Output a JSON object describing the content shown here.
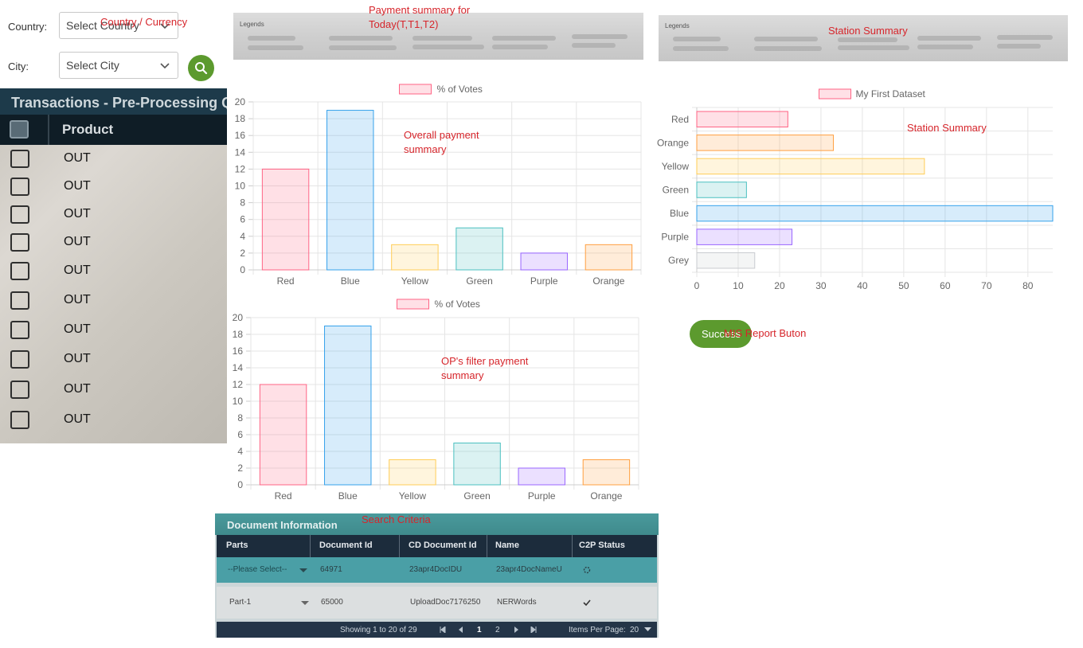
{
  "filters": {
    "country_label": "Country:",
    "country_placeholder": "Select Country",
    "city_label": "City:",
    "city_placeholder": "Select City",
    "search_icon": "search-icon"
  },
  "annotations": {
    "country_currency": "Country / Currency",
    "payment_summary_line1": "Payment summary for",
    "payment_summary_line2": "Today(T,T1,T2)",
    "station_summary_top": "Station Summary",
    "overall_line1": "Overall payment",
    "overall_line2": "summary",
    "op_line1": "OP's filter payment",
    "op_line2": "summary",
    "station_summary_chart": "Station Summary",
    "mis_report": "MIS Report Buton",
    "search_criteria": "Search Criteria"
  },
  "transactions": {
    "title": "Transactions - Pre-Processing Q",
    "column_product": "Product",
    "rows": [
      "OUT",
      "OUT",
      "OUT",
      "OUT",
      "OUT",
      "OUT",
      "OUT",
      "OUT",
      "OUT",
      "OUT"
    ]
  },
  "legend_strip": {
    "title": "Legends"
  },
  "colors": {
    "red": "#ff6384",
    "blue": "#36a2eb",
    "yellow": "#ffcd56",
    "green": "#4bc0c0",
    "purple": "#9966ff",
    "orange": "#ff9f40",
    "grey": "#c9cbcf",
    "accent_green": "#5c9a2e"
  },
  "mis_button": {
    "label": "Success"
  },
  "document_panel": {
    "title": "Document Information",
    "columns": [
      "Parts",
      "Document Id",
      "CD Document Id",
      "Name",
      "C2P Status"
    ],
    "rows": [
      {
        "parts": "--Please Select--",
        "doc_id": "64971",
        "cd_doc_id": "23apr4DocIDU",
        "name": "23apr4DocNameU",
        "status_icon": "spinner-icon"
      },
      {
        "parts": "Part-1",
        "doc_id": "65000",
        "cd_doc_id": "UploadDoc7176250",
        "name": "NERWords",
        "status_icon": "checkmark-icon"
      }
    ],
    "footer": {
      "showing": "Showing 1 to 20 of 29",
      "page_current": "1",
      "page_next": "2",
      "items_label": "Items Per Page:",
      "items_value": "20"
    }
  },
  "chart_data": [
    {
      "type": "bar",
      "legend": "% of Votes",
      "categories": [
        "Red",
        "Blue",
        "Yellow",
        "Green",
        "Purple",
        "Orange"
      ],
      "values": [
        12,
        19,
        3,
        5,
        2,
        3
      ],
      "ylim": [
        0,
        20
      ],
      "yticks": [
        0,
        2,
        4,
        6,
        8,
        10,
        12,
        14,
        16,
        18,
        20
      ],
      "grid": true,
      "legend_position": "top"
    },
    {
      "type": "bar",
      "legend": "% of Votes",
      "categories": [
        "Red",
        "Blue",
        "Yellow",
        "Green",
        "Purple",
        "Orange"
      ],
      "values": [
        12,
        19,
        3,
        5,
        2,
        3
      ],
      "ylim": [
        0,
        20
      ],
      "yticks": [
        0,
        2,
        4,
        6,
        8,
        10,
        12,
        14,
        16,
        18,
        20
      ],
      "grid": true,
      "legend_position": "top"
    },
    {
      "type": "bar",
      "orientation": "horizontal",
      "legend": "My First Dataset",
      "categories": [
        "Red",
        "Orange",
        "Yellow",
        "Green",
        "Blue",
        "Purple",
        "Grey"
      ],
      "values": [
        22,
        33,
        55,
        12,
        86,
        23,
        14
      ],
      "xlim": [
        0,
        86
      ],
      "xticks": [
        0,
        10,
        20,
        30,
        40,
        50,
        60,
        70,
        80
      ],
      "grid": true,
      "legend_position": "top"
    }
  ]
}
